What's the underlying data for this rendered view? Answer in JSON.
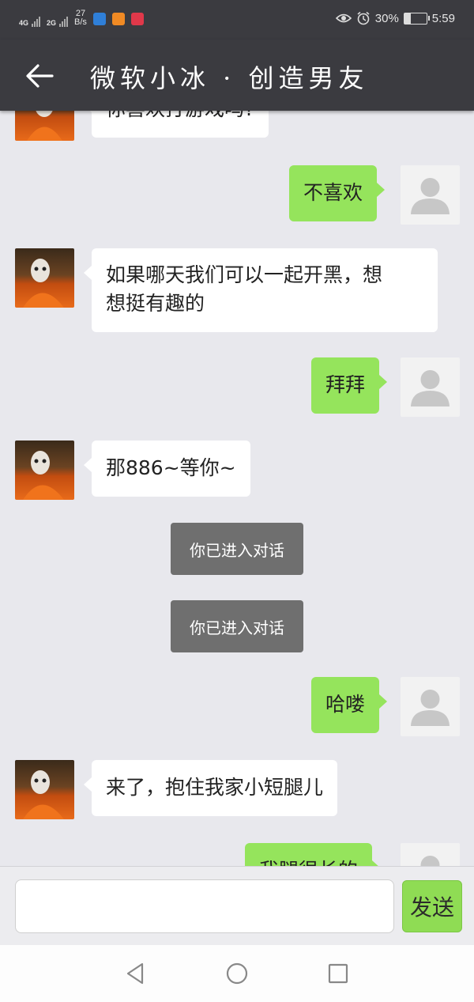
{
  "status_bar": {
    "signal1": "4G",
    "signal2": "2G",
    "net_speed_value": "27",
    "net_speed_unit": "B/s",
    "battery": "30%",
    "time": "5:59"
  },
  "header": {
    "title": "微软小冰 · 创造男友"
  },
  "messages": [
    {
      "from": "bot",
      "text": "你喜欢打游戏吗?"
    },
    {
      "from": "user",
      "text": "不喜欢"
    },
    {
      "from": "bot",
      "lines": [
        "如果哪天我们可以一起开黑，想",
        "想挺有趣的"
      ]
    },
    {
      "from": "user",
      "text": "拜拜"
    },
    {
      "from": "bot",
      "text": "那886~等你~"
    },
    {
      "from": "system",
      "text": "你已进入对话"
    },
    {
      "from": "system",
      "text": "你已进入对话"
    },
    {
      "from": "user",
      "text": "哈喽"
    },
    {
      "from": "bot",
      "text": "来了，抱住我家小短腿儿"
    },
    {
      "from": "user",
      "text": "我腿很长的"
    }
  ],
  "input": {
    "value": "",
    "send_label": "发送"
  },
  "colors": {
    "header_bg": "#3b3b40",
    "bubble_user": "#95e45c",
    "bubble_bot": "#ffffff",
    "system_bg": "#6f6f6f",
    "chat_bg": "#e8e8ed"
  },
  "icons": {
    "back": "arrow-left-icon",
    "nav_back": "triangle-back-icon",
    "nav_home": "circle-home-icon",
    "nav_recent": "square-recent-icon"
  }
}
